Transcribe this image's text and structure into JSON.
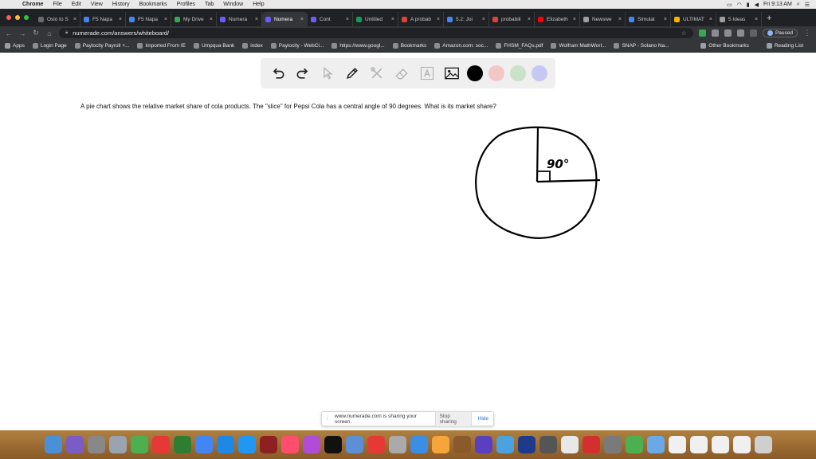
{
  "menubar": {
    "app_name": "Chrome",
    "items": [
      "File",
      "Edit",
      "View",
      "History",
      "Bookmarks",
      "Profiles",
      "Tab",
      "Window",
      "Help"
    ],
    "clock": "Fri 9:13 AM"
  },
  "tabs": [
    {
      "label": "Oslo to S",
      "color": "#6b6b6b",
      "active": false
    },
    {
      "label": "F5 Napa",
      "color": "#4285f4",
      "active": false
    },
    {
      "label": "F5 Napa",
      "color": "#4285f4",
      "active": false
    },
    {
      "label": "My Drive",
      "color": "#34a853",
      "active": false
    },
    {
      "label": "Numera",
      "color": "#6a5cff",
      "active": false
    },
    {
      "label": "Numera",
      "color": "#6a5cff",
      "active": true
    },
    {
      "label": "Cont",
      "color": "#6a5cff",
      "active": false
    },
    {
      "label": "Untitled",
      "color": "#0f9d58",
      "active": false
    },
    {
      "label": "A probab",
      "color": "#db4437",
      "active": false
    },
    {
      "label": "5.2: Joi",
      "color": "#4285f4",
      "active": false
    },
    {
      "label": "probabili",
      "color": "#db4437",
      "active": false
    },
    {
      "label": "Elizabeth",
      "color": "#ff0000",
      "active": false
    },
    {
      "label": "Newswe",
      "color": "#9e9e9e",
      "active": false
    },
    {
      "label": "Simulat",
      "color": "#4285f4",
      "active": false
    },
    {
      "label": "ULTIMAT",
      "color": "#f4b400",
      "active": false
    },
    {
      "label": "5 Ideas",
      "color": "#9e9e9e",
      "active": false
    }
  ],
  "address": {
    "url": "numerade.com/answers/whiteboard/",
    "profile_status": "Paused"
  },
  "bookmarks": {
    "apps_label": "Apps",
    "items": [
      "Login Page",
      "Paylocity Payroll +...",
      "Imported From IE",
      "Umpqua Bank",
      "index",
      "Paylocity - WebCl...",
      "https://www.googl...",
      "Bookmarks",
      "Amazon.com: soc...",
      "FHSM_FAQs.pdf",
      "Wolfram MathWorl...",
      "SNAP - Solano Na..."
    ],
    "other_label": "Other Bookmarks",
    "reading_label": "Reading List"
  },
  "whiteboard": {
    "tools": [
      {
        "name": "undo-icon"
      },
      {
        "name": "redo-icon"
      },
      {
        "name": "pointer-icon"
      },
      {
        "name": "pen-icon"
      },
      {
        "name": "tools-icon"
      },
      {
        "name": "eraser-icon"
      },
      {
        "name": "text-icon"
      },
      {
        "name": "image-icon"
      }
    ],
    "colors": [
      "#000000",
      "#f4c7c7",
      "#c9e2c9",
      "#c7c7f4"
    ],
    "question": "A pie chart shows the relative market share of cola products. The \"slice\" for Pepsi Cola has a central angle of 90 degrees. What is its market share?",
    "annotation": "90°"
  },
  "share_banner": {
    "text": "www.numerade.com is sharing your screen.",
    "stop_label": "Stop sharing",
    "hide_label": "Hide"
  },
  "dock": {
    "icons": [
      "#4a90d9",
      "#7a5cc7",
      "#888888",
      "#9aa4b0",
      "#4caf50",
      "#e53935",
      "#2e7d32",
      "#4285f4",
      "#1e88e5",
      "#2196f3",
      "#8d2020",
      "#ff4d6d",
      "#b04cd6",
      "#111111",
      "#5d8fd6",
      "#e53935",
      "#aaaaaa",
      "#3a8ee6",
      "#f4a63a",
      "#8a5a2a",
      "#5a3fc0",
      "#4aa3df",
      "#1e3a8a",
      "#555555",
      "#e8e8e8",
      "#d32f2f",
      "#7a7a7a",
      "#4caf50",
      "#6aa9e6",
      "#f0f0f0",
      "#f0f0f0",
      "#f0f0f0",
      "#f0f0f0",
      "#cfcfcf"
    ]
  }
}
